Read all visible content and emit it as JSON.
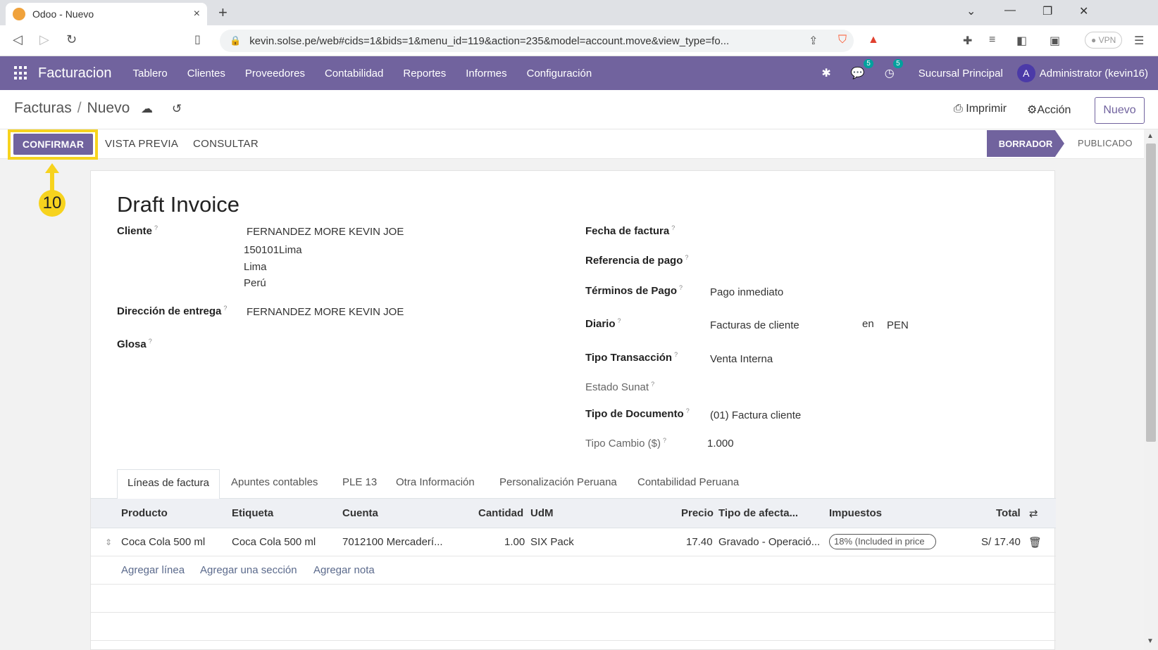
{
  "browser": {
    "tab_title": "Odoo - Nuevo",
    "tab_close": "×",
    "new_tab": "+",
    "url": "kevin.solse.pe/web#cids=1&bids=1&menu_id=119&action=235&model=account.move&view_type=fo...",
    "vpn": "● VPN"
  },
  "navbar": {
    "app": "Facturacion",
    "menus": [
      "Tablero",
      "Clientes",
      "Proveedores",
      "Contabilidad",
      "Reportes",
      "Informes",
      "Configuración"
    ],
    "messages_count": "5",
    "activities_count": "5",
    "branch": "Sucursal Principal",
    "avatar_letter": "A",
    "user": "Administrator (kevin16)"
  },
  "control_panel": {
    "breadcrumb_parent": "Facturas",
    "breadcrumb_sep": "/",
    "breadcrumb_current": "Nuevo",
    "print": "Imprimir",
    "action": "Acción",
    "new": "Nuevo"
  },
  "statusbar": {
    "confirm": "CONFIRMAR",
    "preview": "VISTA PREVIA",
    "consult": "CONSULTAR",
    "state_draft": "BORRADOR",
    "state_posted": "PUBLICADO"
  },
  "annotation": {
    "step": "10",
    "color": "#f7d31e"
  },
  "form": {
    "title": "Draft Invoice",
    "help_mark": "?",
    "cliente_label": "Cliente",
    "cliente_name": "FERNANDEZ MORE KEVIN JOE",
    "cliente_addr1": "150101Lima",
    "cliente_addr2": "Lima",
    "cliente_addr3": "Perú",
    "entrega_label": "Dirección de entrega",
    "entrega_value": "FERNANDEZ MORE KEVIN JOE",
    "glosa_label": "Glosa",
    "fecha_label": "Fecha de factura",
    "referencia_label": "Referencia de pago",
    "terminos_label": "Términos de Pago",
    "terminos_value": "Pago inmediato",
    "diario_label": "Diario",
    "diario_value": "Facturas de cliente",
    "diario_en": "en",
    "diario_currency": "PEN",
    "tipo_trans_label": "Tipo Transacción",
    "tipo_trans_value": "Venta Interna",
    "estado_label": "Estado Sunat",
    "tipo_doc_label": "Tipo de Documento",
    "tipo_doc_value": "(01) Factura cliente",
    "tipo_cambio_label": "Tipo Cambio ($)",
    "tipo_cambio_value": "1.000"
  },
  "notebook": {
    "tabs": [
      "Líneas de factura",
      "Apuntes contables",
      "PLE 13",
      "Otra Información",
      "Personalización Peruana",
      "Contabilidad Peruana"
    ]
  },
  "lines": {
    "headers": [
      "Producto",
      "Etiqueta",
      "Cuenta",
      "Cantidad",
      "UdM",
      "Precio",
      "Tipo de afecta...",
      "Impuestos",
      "Total"
    ],
    "rows": [
      {
        "producto": "Coca Cola 500 ml",
        "etiqueta": "Coca Cola 500 ml",
        "cuenta": "7012100 Mercaderí...",
        "cantidad": "1.00",
        "udm": "SIX Pack",
        "precio": "17.40",
        "tipo": "Gravado - Operació...",
        "impuesto": "18% (Included in price",
        "total": "S/ 17.40"
      }
    ],
    "add_line": "Agregar línea",
    "add_section": "Agregar una sección",
    "add_note": "Agregar nota"
  },
  "colors": {
    "brand": "#71639e",
    "highlight": "#f7d31e"
  }
}
